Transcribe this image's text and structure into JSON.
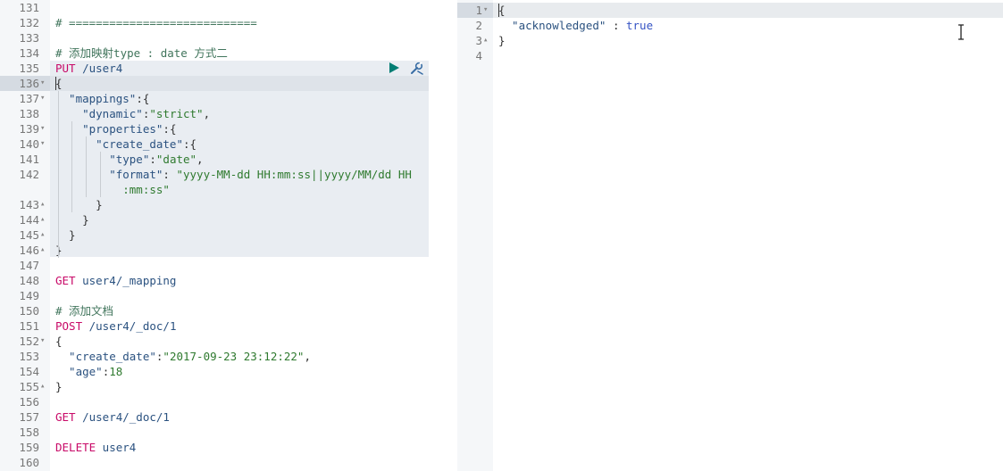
{
  "request_editor": {
    "lines": [
      {
        "n": "131",
        "fold": "",
        "parts": []
      },
      {
        "n": "132",
        "fold": "",
        "parts": [
          {
            "t": "# ============================",
            "c": "comment"
          }
        ]
      },
      {
        "n": "133",
        "fold": "",
        "parts": []
      },
      {
        "n": "134",
        "fold": "",
        "parts": [
          {
            "t": "# 添加映射type : date 方式二",
            "c": "comment"
          }
        ]
      },
      {
        "n": "135",
        "fold": "",
        "parts": [
          {
            "t": "PUT",
            "c": "method"
          },
          {
            "t": " /user4",
            "c": "url"
          }
        ]
      },
      {
        "n": "136",
        "fold": "▾",
        "parts": [
          {
            "t": "{",
            "c": "punc"
          }
        ]
      },
      {
        "n": "137",
        "fold": "▾",
        "parts": [
          {
            "t": "  \"mappings\"",
            "c": "key"
          },
          {
            "t": ":{",
            "c": "punc"
          }
        ]
      },
      {
        "n": "138",
        "fold": "",
        "parts": [
          {
            "t": "    \"dynamic\"",
            "c": "key"
          },
          {
            "t": ":",
            "c": "punc"
          },
          {
            "t": "\"strict\"",
            "c": "str"
          },
          {
            "t": ",",
            "c": "punc"
          }
        ]
      },
      {
        "n": "139",
        "fold": "▾",
        "parts": [
          {
            "t": "    \"properties\"",
            "c": "key"
          },
          {
            "t": ":{",
            "c": "punc"
          }
        ]
      },
      {
        "n": "140",
        "fold": "▾",
        "parts": [
          {
            "t": "      \"create_date\"",
            "c": "key"
          },
          {
            "t": ":{",
            "c": "punc"
          }
        ]
      },
      {
        "n": "141",
        "fold": "",
        "parts": [
          {
            "t": "        \"type\"",
            "c": "key"
          },
          {
            "t": ":",
            "c": "punc"
          },
          {
            "t": "\"date\"",
            "c": "str"
          },
          {
            "t": ",",
            "c": "punc"
          }
        ]
      },
      {
        "n": "142",
        "fold": "",
        "parts": [
          {
            "t": "        \"format\"",
            "c": "key"
          },
          {
            "t": ": ",
            "c": "punc"
          },
          {
            "t": "\"yyyy-MM-dd HH:mm:ss||yyyy/MM/dd HH",
            "c": "str"
          }
        ]
      },
      {
        "n": "",
        "fold": "",
        "parts": [
          {
            "t": "          :mm:ss\"",
            "c": "str"
          }
        ]
      },
      {
        "n": "143",
        "fold": "▴",
        "parts": [
          {
            "t": "      }",
            "c": "punc"
          }
        ]
      },
      {
        "n": "144",
        "fold": "▴",
        "parts": [
          {
            "t": "    }",
            "c": "punc"
          }
        ]
      },
      {
        "n": "145",
        "fold": "▴",
        "parts": [
          {
            "t": "  }",
            "c": "punc"
          }
        ]
      },
      {
        "n": "146",
        "fold": "▴",
        "parts": [
          {
            "t": "}",
            "c": "punc"
          }
        ]
      },
      {
        "n": "147",
        "fold": "",
        "parts": []
      },
      {
        "n": "148",
        "fold": "",
        "parts": [
          {
            "t": "GET",
            "c": "method"
          },
          {
            "t": " user4/_mapping",
            "c": "url"
          }
        ]
      },
      {
        "n": "149",
        "fold": "",
        "parts": []
      },
      {
        "n": "150",
        "fold": "",
        "parts": [
          {
            "t": "# 添加文档",
            "c": "comment"
          }
        ]
      },
      {
        "n": "151",
        "fold": "",
        "parts": [
          {
            "t": "POST",
            "c": "method"
          },
          {
            "t": " /user4/_doc/1",
            "c": "url"
          }
        ]
      },
      {
        "n": "152",
        "fold": "▾",
        "parts": [
          {
            "t": "{",
            "c": "punc"
          }
        ]
      },
      {
        "n": "153",
        "fold": "",
        "parts": [
          {
            "t": "  \"create_date\"",
            "c": "key"
          },
          {
            "t": ":",
            "c": "punc"
          },
          {
            "t": "\"2017-09-23 23:12:22\"",
            "c": "str"
          },
          {
            "t": ",",
            "c": "punc"
          }
        ]
      },
      {
        "n": "154",
        "fold": "",
        "parts": [
          {
            "t": "  \"age\"",
            "c": "key"
          },
          {
            "t": ":",
            "c": "punc"
          },
          {
            "t": "18",
            "c": "num"
          }
        ]
      },
      {
        "n": "155",
        "fold": "▴",
        "parts": [
          {
            "t": "}",
            "c": "punc"
          }
        ]
      },
      {
        "n": "156",
        "fold": "",
        "parts": []
      },
      {
        "n": "157",
        "fold": "",
        "parts": [
          {
            "t": "GET",
            "c": "method"
          },
          {
            "t": " /user4/_doc/1",
            "c": "url"
          }
        ]
      },
      {
        "n": "158",
        "fold": "",
        "parts": []
      },
      {
        "n": "159",
        "fold": "",
        "parts": [
          {
            "t": "DELETE",
            "c": "method"
          },
          {
            "t": " user4",
            "c": "url"
          }
        ]
      },
      {
        "n": "160",
        "fold": "",
        "parts": []
      }
    ],
    "run_icon": "play-icon",
    "settings_icon": "wrench-icon"
  },
  "response_viewer": {
    "lines": [
      {
        "n": "1",
        "fold": "▾",
        "parts": [
          {
            "t": "{",
            "c": "punc"
          }
        ]
      },
      {
        "n": "2",
        "fold": "",
        "parts": [
          {
            "t": "  \"acknowledged\"",
            "c": "key"
          },
          {
            "t": " : ",
            "c": "punc"
          },
          {
            "t": "true",
            "c": "bool"
          }
        ]
      },
      {
        "n": "3",
        "fold": "▴",
        "parts": [
          {
            "t": "}",
            "c": "punc"
          }
        ]
      },
      {
        "n": "4",
        "fold": "",
        "parts": []
      }
    ]
  },
  "colors": {
    "method": "#c80a68",
    "comment": "#41755c",
    "string": "#2f7a2f",
    "key": "#2b5280",
    "run_button": "#017d73",
    "selection": "#e9edf2"
  }
}
